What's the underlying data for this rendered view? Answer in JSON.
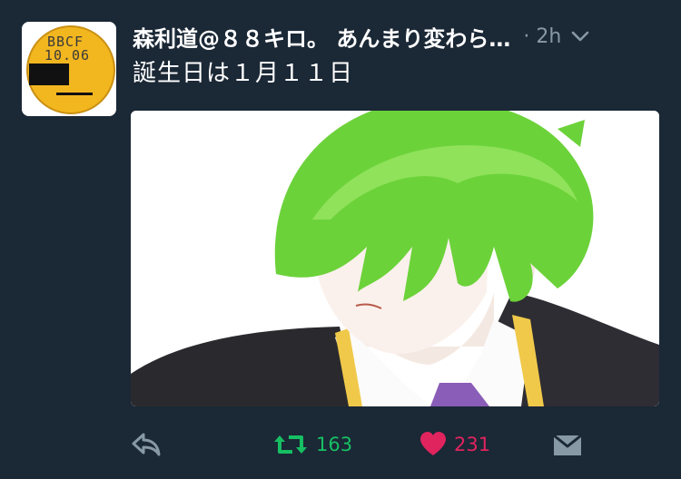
{
  "avatar": {
    "text_top": "BBCF",
    "text_bottom": "10.06",
    "coin_color": "#f2b61f",
    "icon": "gold-coin-avatar"
  },
  "header": {
    "display_name": "森利道@８８キロ。 あんまり変わら…",
    "timestamp": "· 2h",
    "menu_icon": "chevron-down-icon"
  },
  "tweet": {
    "text": "誕生日は１月１１日"
  },
  "media": {
    "description_icon": "anime-illustration-green-hair"
  },
  "actions": {
    "reply_icon": "reply-icon",
    "retweet_icon": "retweet-icon",
    "retweet_count": "163",
    "like_icon": "heart-icon",
    "like_count": "231",
    "dm_icon": "envelope-icon"
  },
  "colors": {
    "background": "#1b2836",
    "muted": "#8899a6",
    "retweet_green": "#17bf63",
    "like_red": "#e0245e"
  }
}
